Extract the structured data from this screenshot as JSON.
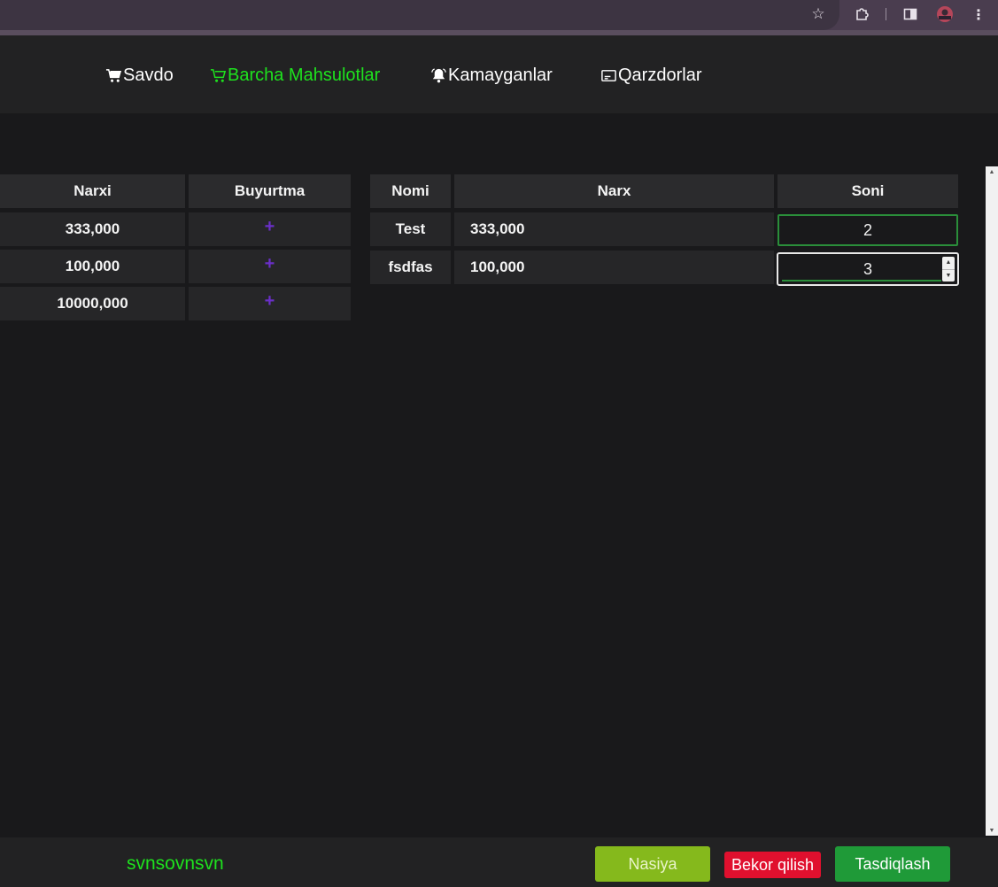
{
  "browser": {
    "star_icon": "star-icon",
    "menu_icon": "more-vert-icon"
  },
  "nav": {
    "items": [
      {
        "label": "Savdo",
        "icon": "cart-icon",
        "active": false
      },
      {
        "label": "Barcha Mahsulotlar",
        "icon": "cart-icon",
        "active": true
      },
      {
        "label": "Kamayganlar",
        "icon": "bell-icon",
        "active": false
      },
      {
        "label": "Qarzdorlar",
        "icon": "card-icon",
        "active": false
      }
    ],
    "active_color": "#1ee21e"
  },
  "products_table": {
    "headers": [
      "Narxi",
      "Buyurtma"
    ],
    "rows": [
      {
        "price": "333,000",
        "action": "+"
      },
      {
        "price": "100,000",
        "action": "+"
      },
      {
        "price": "10000,000",
        "action": "+"
      }
    ]
  },
  "order_table": {
    "headers": [
      "Nomi",
      "Narx",
      "Soni"
    ],
    "rows": [
      {
        "name": "Test",
        "price": "333,000",
        "qty": "2"
      },
      {
        "name": "fsdfas",
        "price": "100,000",
        "qty": "3"
      }
    ]
  },
  "footer": {
    "customer_name": "svnsovnsvn",
    "buttons": {
      "nasiya": "Nasiya",
      "bekor": "Bekor qilish",
      "tasdiq": "Tasdiqlash"
    }
  },
  "colors": {
    "accent_green": "#1ee21e",
    "nasiya": "#85b91c",
    "cancel": "#e0102e",
    "confirm": "#1f9a38",
    "plus": "#6a2fc8"
  }
}
